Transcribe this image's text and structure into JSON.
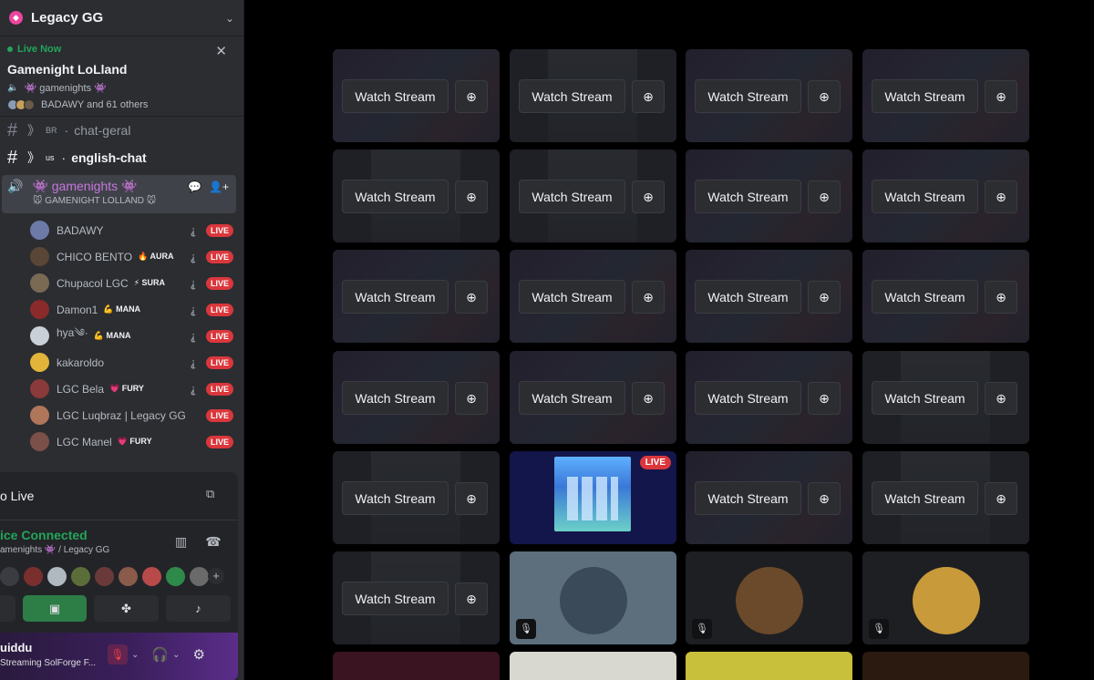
{
  "server": {
    "name": "Legacy GG"
  },
  "live_event": {
    "status": "Live Now",
    "title": "Gamenight LoLland",
    "channel": "👾 gamenights 👾",
    "attendees": "BADAWY and 61 others"
  },
  "channels": [
    {
      "prefix": "》",
      "flag": "BR",
      "name": "chat-geral"
    },
    {
      "prefix": "》",
      "flag": "us",
      "name": "english-chat"
    }
  ],
  "voice_channel": {
    "name": "👾 gamenights 👾",
    "subtitle": "🐭 GAMENIGHT LOLLAND 🐭"
  },
  "members": [
    {
      "name": "BADAWY",
      "tag": "",
      "live": "LIVE",
      "deaf": true,
      "color": "#6d7aa8"
    },
    {
      "name": "CHICO BENTO",
      "tag": "🔥 AURA",
      "live": "LIVE",
      "deaf": true,
      "color": "#5a4636"
    },
    {
      "name": "Chupacol LGC",
      "tag": "⚡ SURA",
      "live": "LIVE",
      "deaf": true,
      "color": "#7a6a54"
    },
    {
      "name": "Damon1",
      "tag": "💪 MANA",
      "live": "LIVE",
      "deaf": true,
      "color": "#8a2a2a"
    },
    {
      "name": "hya༄·",
      "tag": "💪 MANA",
      "live": "LIVE",
      "deaf": true,
      "color": "#c9d0d8"
    },
    {
      "name": "kakaroldo",
      "tag": "",
      "live": "LIVE",
      "deaf": true,
      "color": "#e2b43a"
    },
    {
      "name": "LGC Bela",
      "tag": "💗 FURY",
      "live": "LIVE",
      "deaf": true,
      "color": "#8a3a3a"
    },
    {
      "name": "LGC Luqbraz | Legacy GG",
      "tag": "",
      "live": "LIVE",
      "deaf": false,
      "color": "#b0765a"
    },
    {
      "name": "LGC Manel",
      "tag": "💗 FURY",
      "live": "LIVE",
      "deaf": false,
      "color": "#7a5048"
    }
  ],
  "go_live": {
    "title": "o Live"
  },
  "voice_connected": {
    "status": "ice Connected",
    "channel": "amenights 👾 / Legacy GG"
  },
  "user": {
    "name": "uiddu",
    "status": "Streaming SolForge F..."
  },
  "stream_tiles": {
    "watch_label": "Watch Stream",
    "live_label": "LIVE"
  },
  "colors": {
    "sidebar": "#2b2d31",
    "live_red": "#da373c",
    "online_green": "#23a55a",
    "background": "#000000"
  }
}
